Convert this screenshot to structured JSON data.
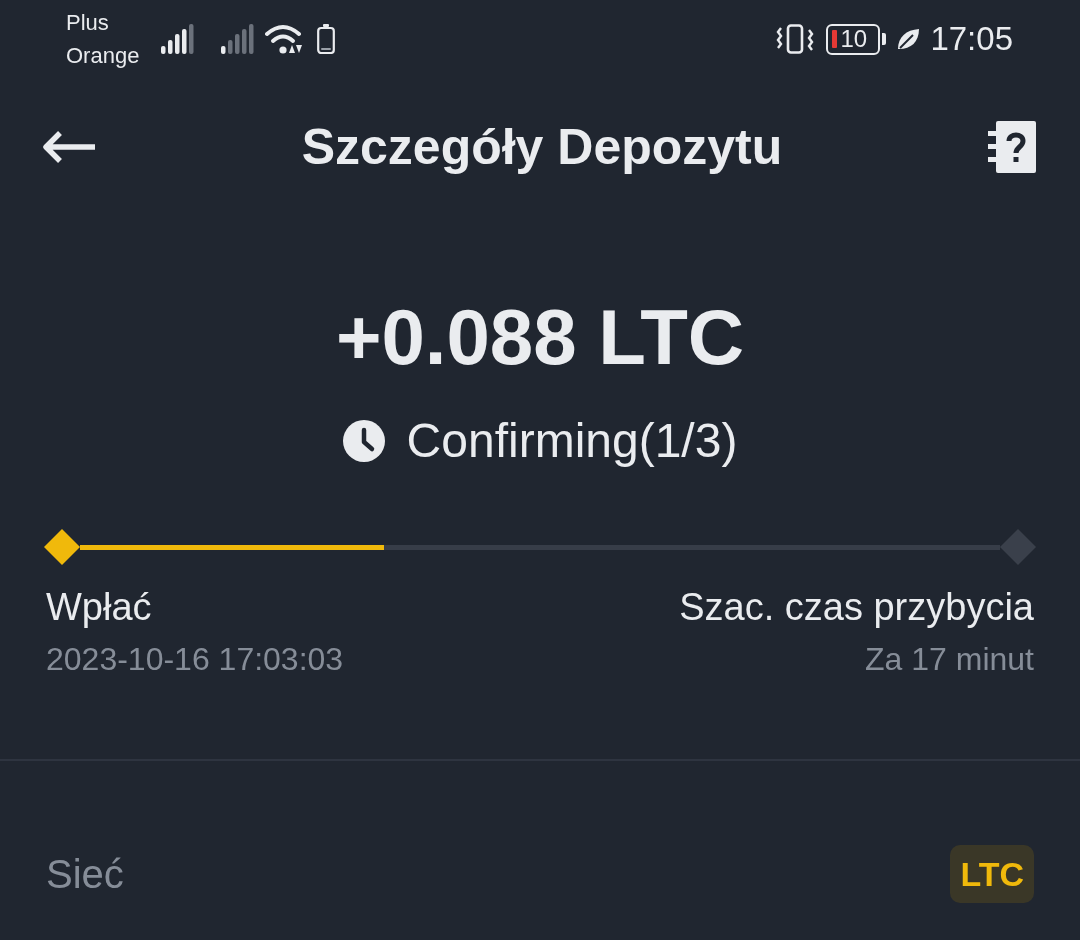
{
  "status_bar": {
    "carrier": [
      "Plus",
      "Orange"
    ],
    "battery": "10",
    "time": "17:05"
  },
  "header": {
    "title": "Szczegóły Depozytu"
  },
  "amount": "+0.088 LTC",
  "status": {
    "label": "Confirming(1/3)"
  },
  "progress": {
    "level": 0.33,
    "steps": [
      {
        "label": "Wpłać",
        "detail": "2023-10-16 17:03:03",
        "reached": true
      },
      {
        "label": "Szac. czas przybycia",
        "detail": "Za 17 minut",
        "reached": false
      }
    ]
  },
  "details": [
    {
      "label": "Sieć",
      "value": "LTC"
    }
  ]
}
